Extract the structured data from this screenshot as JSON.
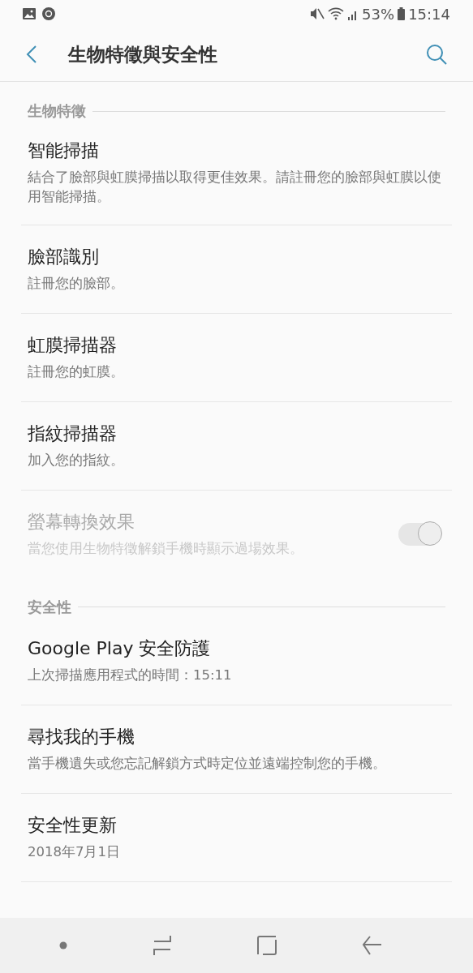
{
  "status_bar": {
    "battery": "53%",
    "time": "15:14"
  },
  "header": {
    "title": "生物特徵與安全性"
  },
  "sections": [
    {
      "title": "生物特徵",
      "items": [
        {
          "kind": "plain",
          "title": "智能掃描",
          "subtitle": "結合了臉部與虹膜掃描以取得更佳效果。請註冊您的臉部與虹膜以使用智能掃描。",
          "disabled": false
        },
        {
          "kind": "plain",
          "title": "臉部識別",
          "subtitle": "註冊您的臉部。",
          "disabled": false
        },
        {
          "kind": "plain",
          "title": "虹膜掃描器",
          "subtitle": "註冊您的虹膜。",
          "disabled": false
        },
        {
          "kind": "plain",
          "title": "指紋掃描器",
          "subtitle": "加入您的指紋。",
          "disabled": false
        },
        {
          "kind": "switch",
          "title": "螢幕轉換效果",
          "subtitle": "當您使用生物特徵解鎖手機時顯示過場效果。",
          "disabled": true,
          "on": true
        }
      ]
    },
    {
      "title": "安全性",
      "items": [
        {
          "kind": "plain",
          "title": "Google Play 安全防護",
          "subtitle": "上次掃描應用程式的時間：15:11",
          "disabled": false
        },
        {
          "kind": "plain",
          "title": "尋找我的手機",
          "subtitle": "當手機遺失或您忘記解鎖方式時定位並遠端控制您的手機。",
          "disabled": false
        },
        {
          "kind": "plain",
          "title": "安全性更新",
          "subtitle": "2018年7月1日",
          "disabled": false
        }
      ]
    }
  ]
}
